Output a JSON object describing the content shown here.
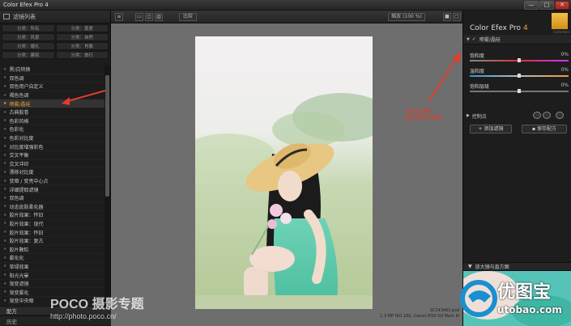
{
  "window": {
    "title": "Color Efex Pro 4",
    "controls": [
      "—",
      "□",
      "✕"
    ]
  },
  "left_panel": {
    "header_label": "滤镜列表",
    "categories": [
      "分类：所有",
      "分类：喜爱",
      "分类：风景",
      "分类：自然",
      "分类：婚礼",
      "分类：肖像",
      "分类：建筑",
      "分类：旅行"
    ],
    "filters": [
      "黑/白转换",
      "双色调",
      "双色用户自定义",
      "褐色色调",
      "喷雾/晶硅",
      "古典胶卷",
      "色彩风格",
      "色彩化",
      "色彩对比度",
      "对比度增强彩色",
      "交叉平衡",
      "交叉冲印",
      "漂移对比度",
      "变暗 / 变亮中心点",
      "详细提取滤镜",
      "双色调",
      "动态皮肤柔化器",
      "胶片效果：怀旧",
      "胶片效果：现代",
      "胶片效果：怀旧",
      "胶片效果：复古",
      "胶片颗粒",
      "雾化化",
      "草绿效果",
      "阳光光晕",
      "渐变滤镜",
      "渐变雾化",
      "渐变中央暗"
    ],
    "selected_filter": "喷雾/晶硅",
    "footer_1": "配方",
    "footer_2": "历史"
  },
  "toolbar": {
    "compare_label": "比较",
    "zoom_label": "缩放 (100 %)"
  },
  "photo": {
    "filename": "SC143462.psd",
    "meta": "1.3 MP ISO 160, Canon EOS 5D Mark III"
  },
  "right_panel": {
    "brand": "Color Efex Pro",
    "brand_version": "4",
    "nik_text": "Collection",
    "filter_header": "喷雾/晶硅",
    "sliders": [
      {
        "label": "饱和度",
        "value": "0%",
        "level": 0.5
      },
      {
        "label": "温和度",
        "value": "0%",
        "level": 0.5
      },
      {
        "label": "饱和层级",
        "value": "0%",
        "level": 0.5
      }
    ],
    "control_points": "控制点",
    "add_filter": "添加滤镜",
    "save_recipe": "保存配方",
    "loupe_header": "放大镜与直方图"
  },
  "annotation": {
    "line1": "这对比调整",
    "line2": "温和度添加温暖"
  },
  "watermarks": {
    "poco_1": "POCO 摄影专题",
    "poco_2": "http://photo.poco.cn/",
    "utobao_1": "优图宝",
    "utobao_2": "utobao.com"
  },
  "colors": {
    "accent": "#f0a030",
    "annotation": "#e43b2b",
    "panel_bg": "#1d1d1d",
    "canvas_bg": "#6e6e6e"
  }
}
